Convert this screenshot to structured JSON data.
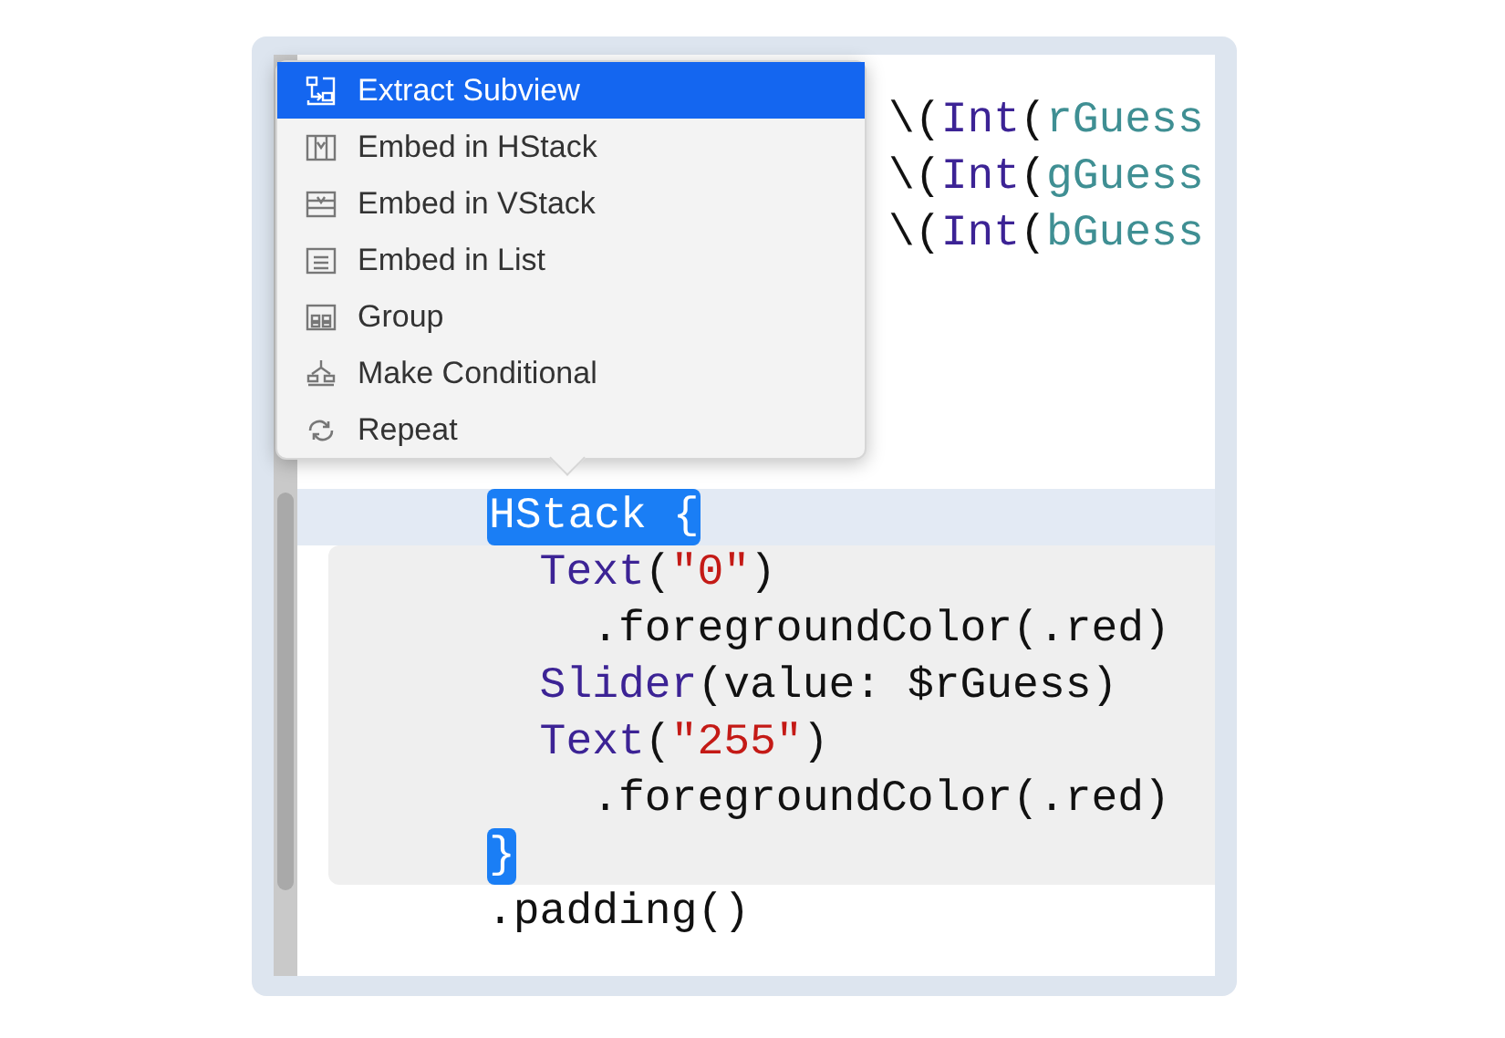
{
  "menu": {
    "items": [
      {
        "label": "Extract Subview",
        "selected": true
      },
      {
        "label": "Embed in HStack",
        "selected": false
      },
      {
        "label": "Embed in VStack",
        "selected": false
      },
      {
        "label": "Embed in List",
        "selected": false
      },
      {
        "label": "Group",
        "selected": false
      },
      {
        "label": "Make Conditional",
        "selected": false
      },
      {
        "label": "Repeat",
        "selected": false
      }
    ]
  },
  "editor": {
    "obscured_lines": [
      {
        "tokens": [
          {
            "kind": "plain",
            "text": "\\("
          },
          {
            "kind": "type",
            "text": "Int"
          },
          {
            "kind": "plain",
            "text": "("
          },
          {
            "kind": "ident",
            "text": "rGuess"
          }
        ]
      },
      {
        "tokens": [
          {
            "kind": "plain",
            "text": "\\("
          },
          {
            "kind": "type",
            "text": "Int"
          },
          {
            "kind": "plain",
            "text": "("
          },
          {
            "kind": "ident",
            "text": "gGuess"
          }
        ]
      },
      {
        "tokens": [
          {
            "kind": "plain",
            "text": "\\("
          },
          {
            "kind": "type",
            "text": "Int"
          },
          {
            "kind": "plain",
            "text": "("
          },
          {
            "kind": "ident",
            "text": "bGuess"
          }
        ]
      }
    ],
    "lines": [
      {
        "current": true,
        "selected": true,
        "scoped": true,
        "tokens": [
          {
            "kind": "plain",
            "text": "HStack {"
          }
        ],
        "children": [
          {
            "tokens": [
              {
                "kind": "type",
                "text": "Text"
              },
              {
                "kind": "plain",
                "text": "("
              },
              {
                "kind": "string",
                "text": "\"0\""
              },
              {
                "kind": "plain",
                "text": ")"
              }
            ],
            "children": [
              {
                "tokens": [
                  {
                    "kind": "plain",
                    "text": ".foregroundColor(.red)"
                  }
                ]
              }
            ]
          },
          {
            "tokens": [
              {
                "kind": "type",
                "text": "Slider"
              },
              {
                "kind": "plain",
                "text": "(value: $rGuess)"
              }
            ]
          },
          {
            "tokens": [
              {
                "kind": "type",
                "text": "Text"
              },
              {
                "kind": "plain",
                "text": "("
              },
              {
                "kind": "string",
                "text": "\"255\""
              },
              {
                "kind": "plain",
                "text": ")"
              }
            ],
            "children": [
              {
                "tokens": [
                  {
                    "kind": "plain",
                    "text": ".foregroundColor(.red)"
                  }
                ]
              }
            ]
          }
        ],
        "closing": {
          "selected": true,
          "tokens": [
            {
              "kind": "plain",
              "text": "}"
            }
          ]
        }
      },
      {
        "tokens": [
          {
            "kind": "plain",
            "text": ".padding()"
          }
        ]
      }
    ]
  }
}
